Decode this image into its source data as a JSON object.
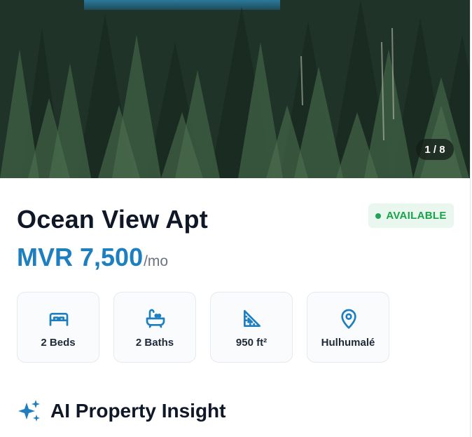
{
  "gallery": {
    "counter": "1 / 8"
  },
  "listing": {
    "title": "Ocean View Apt",
    "status": "AVAILABLE",
    "price": "MVR 7,500",
    "price_period": "/mo"
  },
  "features": [
    {
      "icon": "bed-icon",
      "label": "2 Beds"
    },
    {
      "icon": "bath-icon",
      "label": "2 Baths"
    },
    {
      "icon": "area-ruler-icon",
      "label": "950 ft²"
    },
    {
      "icon": "location-pin-icon",
      "label": "Hulhumalé"
    }
  ],
  "ai_insight": {
    "icon": "sparkles-icon",
    "title": "AI Property Insight"
  },
  "colors": {
    "accent": "#1d7fc0",
    "status_bg": "#e9f7ef",
    "status_text": "#16a34a"
  }
}
